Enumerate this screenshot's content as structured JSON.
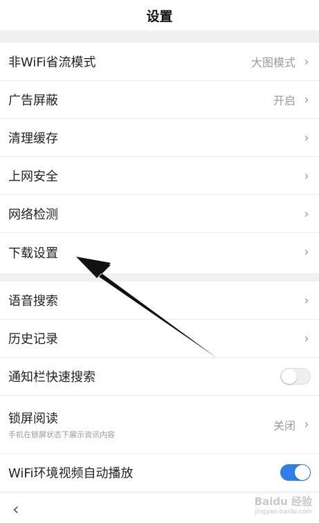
{
  "header": {
    "title": "设置"
  },
  "section1": [
    {
      "label": "非WiFi省流模式",
      "value": "大图模式"
    },
    {
      "label": "广告屏蔽",
      "value": "开启"
    },
    {
      "label": "清理缓存",
      "value": ""
    },
    {
      "label": "上网安全",
      "value": ""
    },
    {
      "label": "网络检测",
      "value": ""
    },
    {
      "label": "下载设置",
      "value": ""
    }
  ],
  "section2": {
    "voice_search": {
      "label": "语音搜索"
    },
    "history": {
      "label": "历史记录"
    },
    "notify_search": {
      "label": "通知栏快速搜索",
      "toggle": "off"
    },
    "lock_read": {
      "label": "锁屏阅读",
      "sub": "手机在锁屏状态下展示资讯内容",
      "value": "关闭"
    },
    "wifi_autoplay": {
      "label": "WiFi环境视频自动播放",
      "toggle": "on"
    }
  },
  "icons": {
    "chevron": "›",
    "back": "‹"
  },
  "watermark": {
    "text": "Baidu 经验",
    "url": "jingyan.baidu.com"
  },
  "colors": {
    "toggle_on": "#2f7fe6",
    "arrow": "#111111"
  }
}
